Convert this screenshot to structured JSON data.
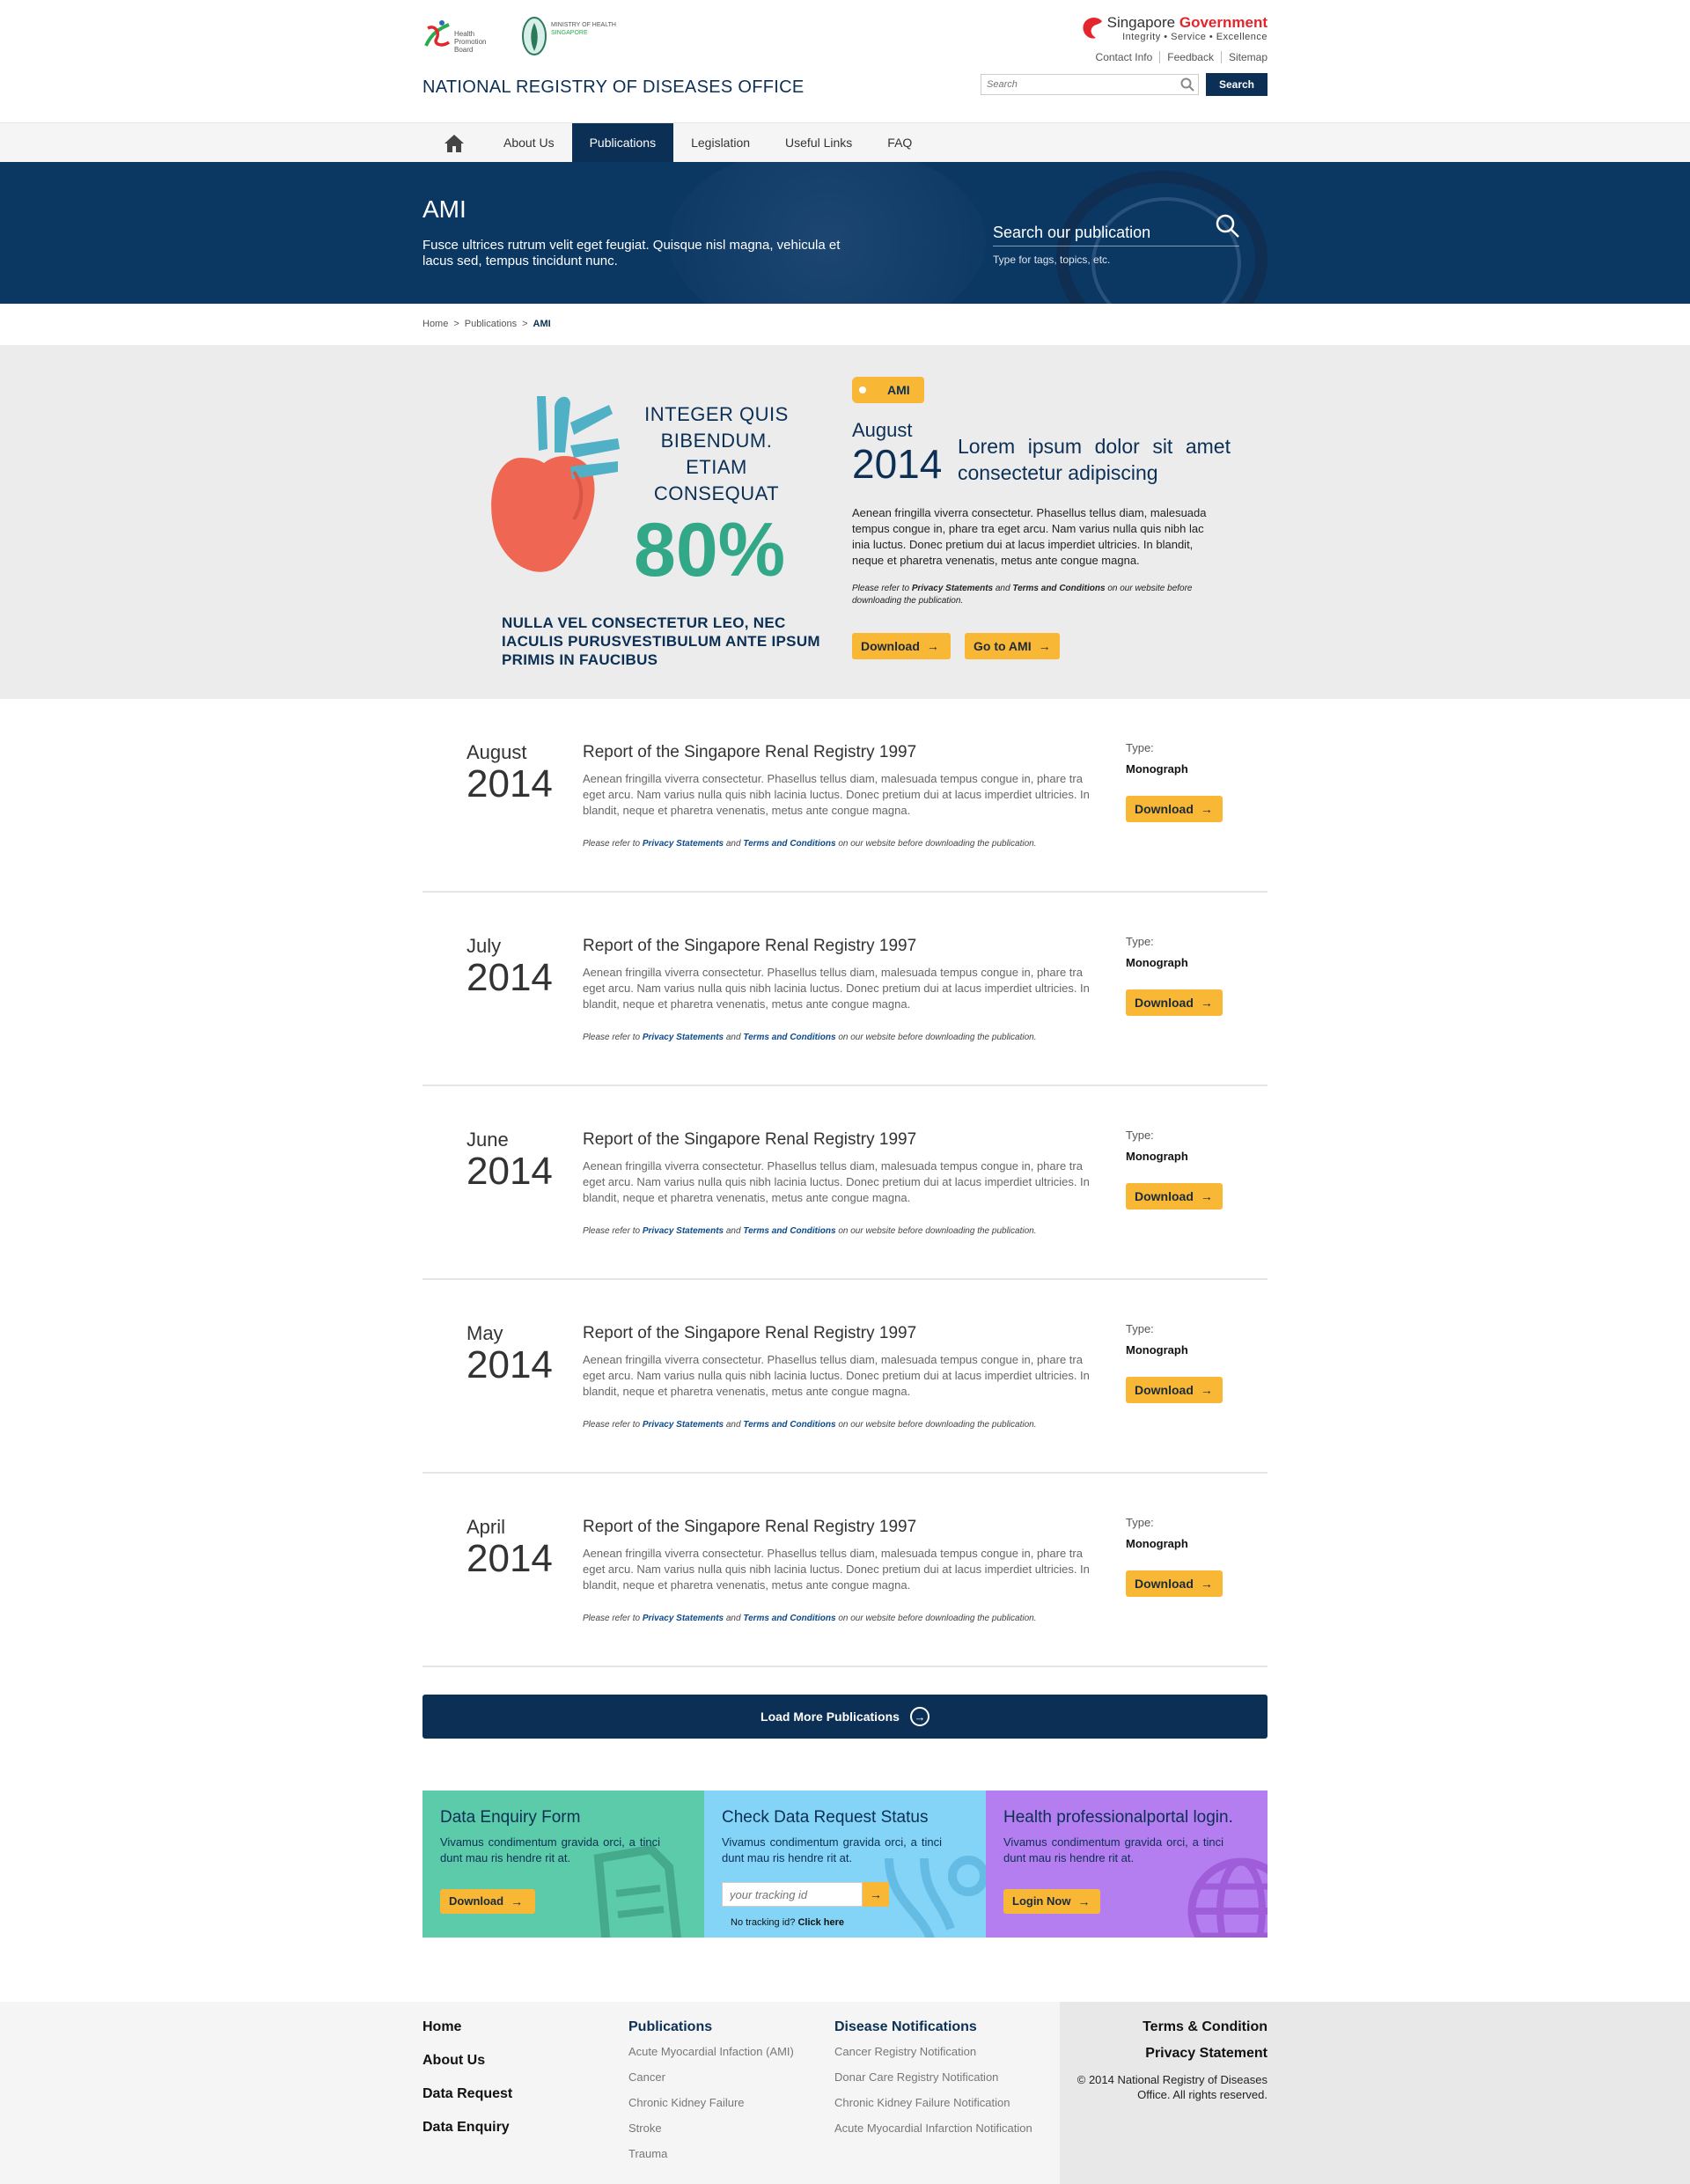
{
  "header": {
    "hpb_logo_text": "Health Promotion Board",
    "moh_logo_text": "MINISTRY OF HEALTH",
    "moh_logo_sub": "SINGAPORE",
    "site_title": "NATIONAL REGISTRY OF DISEASES OFFICE",
    "gov_name_plain": "Singapore",
    "gov_name_bold": "Government",
    "gov_motto": "Integrity • Service • Excellence",
    "util_links": [
      "Contact Info",
      "Feedback",
      "Sitemap"
    ],
    "search_placeholder": "Search",
    "search_button": "Search"
  },
  "nav": {
    "items": [
      "About Us",
      "Publications",
      "Legislation",
      "Useful Links",
      "FAQ"
    ],
    "active": "Publications"
  },
  "banner": {
    "title": "AMI",
    "text": "Fusce ultrices rutrum velit eget feugiat. Quisque nisl magna, vehicula et lacus sed, tempus tincidunt nunc.",
    "search_placeholder": "Search our publication",
    "search_hint": "Type for tags, topics, etc."
  },
  "breadcrumb": [
    "Home",
    "Publications",
    "AMI"
  ],
  "feature": {
    "question": "INTEGER QUIS BIBENDUM. ETIAM CONSEQUAT",
    "percent": "80%",
    "caption": "NULLA VEL CONSECTETUR LEO, NEC IACULIS PURUSVESTIBULUM ANTE IPSUM PRIMIS IN FAUCIBUS",
    "tag": "AMI",
    "month": "August",
    "year": "2014",
    "title": "Lorem ipsum dolor sit amet consectetur adipiscing",
    "body": "Aenean fringilla viverra consectetur. Phasellus tellus diam, malesuada tempus congue in, phare tra eget arcu. Nam varius nulla quis nibh lac inia luctus. Donec pretium dui at lacus imperdiet ultricies. In blandit, neque et pharetra venenatis, metus ante congue magna.",
    "note_pre": "Please refer to ",
    "note_link1": "Privacy Statements",
    "note_mid": " and ",
    "note_link2": "Terms and Conditions",
    "note_post": " on our website before downloading the publication.",
    "download_label": "Download",
    "goto_label": "Go to AMI"
  },
  "publications": [
    {
      "month": "August",
      "year": "2014",
      "title": "Report of the Singapore Renal Registry 1997",
      "body": "Aenean fringilla viverra consectetur. Phasellus tellus diam, malesuada tempus congue in, phare tra eget arcu. Nam varius nulla quis nibh lacinia luctus. Donec pretium dui at lacus imperdiet ultricies. In blandit, neque et pharetra venenatis, metus ante congue magna.",
      "type_label": "Type:",
      "type": "Monograph",
      "download": "Download"
    },
    {
      "month": "July",
      "year": "2014",
      "title": "Report of the Singapore Renal Registry 1997",
      "body": "Aenean fringilla viverra consectetur. Phasellus tellus diam, malesuada tempus congue in, phare tra eget arcu. Nam varius nulla quis nibh lacinia luctus. Donec pretium dui at lacus imperdiet ultricies. In blandit, neque et pharetra venenatis, metus ante congue magna.",
      "type_label": "Type:",
      "type": "Monograph",
      "download": "Download"
    },
    {
      "month": "June",
      "year": "2014",
      "title": "Report of the Singapore Renal Registry 1997",
      "body": "Aenean fringilla viverra consectetur. Phasellus tellus diam, malesuada tempus congue in, phare tra eget arcu. Nam varius nulla quis nibh lacinia luctus. Donec pretium dui at lacus imperdiet ultricies. In blandit, neque et pharetra venenatis, metus ante congue magna.",
      "type_label": "Type:",
      "type": "Monograph",
      "download": "Download"
    },
    {
      "month": "May",
      "year": "2014",
      "title": "Report of the Singapore Renal Registry 1997",
      "body": "Aenean fringilla viverra consectetur. Phasellus tellus diam, malesuada tempus congue in, phare tra eget arcu. Nam varius nulla quis nibh lacinia luctus. Donec pretium dui at lacus imperdiet ultricies. In blandit, neque et pharetra venenatis, metus ante congue magna.",
      "type_label": "Type:",
      "type": "Monograph",
      "download": "Download"
    },
    {
      "month": "April",
      "year": "2014",
      "title": "Report of the Singapore Renal Registry 1997",
      "body": "Aenean fringilla viverra consectetur. Phasellus tellus diam, malesuada tempus congue in, phare tra eget arcu. Nam varius nulla quis nibh lacinia luctus. Donec pretium dui at lacus imperdiet ultricies. In blandit, neque et pharetra venenatis, metus ante congue magna.",
      "type_label": "Type:",
      "type": "Monograph",
      "download": "Download"
    }
  ],
  "pub_note": {
    "pre": "Please refer to ",
    "link1": "Privacy Statements",
    "mid": " and ",
    "link2": "Terms and Conditions",
    "post": " on our website before downloading the publication."
  },
  "load_more": "Load More Publications",
  "cards": {
    "enquiry": {
      "title": "Data Enquiry Form",
      "text": "Vivamus condimentum gravida orci, a tinci dunt mau ris hendre rit at.",
      "button": "Download",
      "color": "#5ccba9"
    },
    "status": {
      "title": "Check Data Request Status",
      "text": "Vivamus condimentum gravida orci, a tinci dunt mau ris hendre rit at.",
      "placeholder": "your tracking id",
      "no_track": "No tracking id?",
      "click_here": "Click here",
      "color": "#83d4f6"
    },
    "portal": {
      "title": "Health professionalportal login.",
      "text": "Vivamus condimentum gravida orci, a tinci dunt mau ris hendre rit at.",
      "button": "Login Now",
      "color": "#b57ef0"
    }
  },
  "footer": {
    "main_links": [
      "Home",
      "About Us",
      "Data Request",
      "Data Enquiry"
    ],
    "publications_head": "Publications",
    "publications": [
      "Acute Myocardial Infaction (AMI)",
      "Cancer",
      "Chronic Kidney Failure",
      "Stroke",
      "Trauma"
    ],
    "notifications_head": "Disease Notifications",
    "notifications": [
      "Cancer Registry Notification",
      "Donar Care Registry Notification",
      "Chronic Kidney Failure Notification",
      "Acute Myocardial Infarction Notification"
    ],
    "terms": "Terms & Condition",
    "privacy": "Privacy Statement",
    "copyright": "© 2014 National Registry of Diseases Office. All rights reserved."
  },
  "colors": {
    "navy": "#0b2f55",
    "accent": "#f8b734",
    "green_pct": "#32a889",
    "heart": "#ef6652",
    "heart_vessels": "#4fb0c6"
  }
}
